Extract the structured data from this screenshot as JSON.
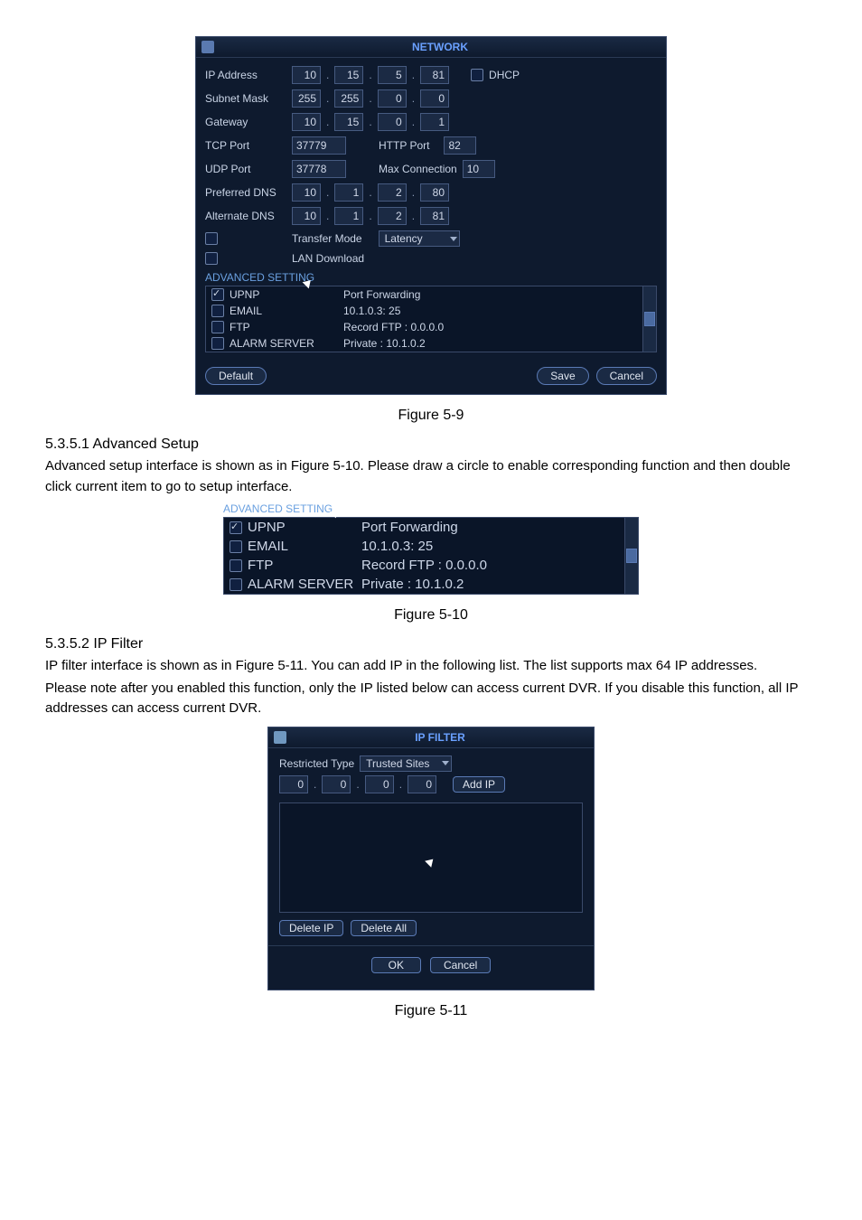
{
  "network": {
    "title_bar_icon_name": "computers-icon",
    "title": "NETWORK",
    "fields": {
      "ip_address_label": "IP Address",
      "ip_address": [
        "10",
        "15",
        "5",
        "81"
      ],
      "dhcp_label": "DHCP",
      "subnet_mask_label": "Subnet Mask",
      "subnet_mask": [
        "255",
        "255",
        "0",
        "0"
      ],
      "gateway_label": "Gateway",
      "gateway": [
        "10",
        "15",
        "0",
        "1"
      ],
      "tcp_port_label": "TCP Port",
      "tcp_port": "37779",
      "http_port_label": "HTTP Port",
      "http_port": "82",
      "udp_port_label": "UDP Port",
      "udp_port": "37778",
      "max_conn_label": "Max Connection",
      "max_conn": "10",
      "preferred_dns_label": "Preferred DNS",
      "preferred_dns": [
        "10",
        "1",
        "2",
        "80"
      ],
      "alternate_dns_label": "Alternate DNS",
      "alternate_dns": [
        "10",
        "1",
        "2",
        "81"
      ],
      "transfer_mode_label": "Transfer Mode",
      "transfer_mode_value": "Latency",
      "lan_download_label": "LAN Download",
      "advanced_setting_label": "ADVANCED SETTING",
      "adv": [
        {
          "name": "UPNP",
          "value": "Port Forwarding",
          "checked": true
        },
        {
          "name": "EMAIL",
          "value": "10.1.0.3: 25",
          "checked": false
        },
        {
          "name": "FTP",
          "value": "Record FTP : 0.0.0.0",
          "checked": false
        },
        {
          "name": "ALARM SERVER",
          "value": "Private : 10.1.0.2",
          "checked": false
        }
      ]
    },
    "buttons": {
      "default": "Default",
      "save": "Save",
      "cancel": "Cancel"
    }
  },
  "figures": {
    "fig59": "Figure 5-9",
    "fig510": "Figure 5-10",
    "fig511": "Figure 5-11"
  },
  "doc": {
    "h1": "5.3.5.1  Advanced Setup",
    "p1": "Advanced setup interface is shown as in Figure 5-10. Please draw a circle to enable corresponding function and then double click current item to go to setup interface.",
    "h2": "5.3.5.2  IP Filter",
    "p2a": "IP filter interface is shown as in Figure 5-11. You can add IP in the following list.  The list supports max 64 IP addresses.",
    "p2b": "Please note after you enabled this function, only the IP listed below can access current DVR. If you disable this function, all IP addresses can access current DVR."
  },
  "advsetting_small": {
    "title": "ADVANCED SETTING",
    "items": [
      {
        "name": "UPNP",
        "value": "Port Forwarding",
        "checked": true
      },
      {
        "name": "EMAIL",
        "value": "10.1.0.3: 25",
        "checked": false
      },
      {
        "name": "FTP",
        "value": "Record FTP : 0.0.0.0",
        "checked": false
      },
      {
        "name": "ALARM SERVER",
        "value": "Private : 10.1.0.2",
        "checked": false
      }
    ]
  },
  "ipfilter": {
    "title_icon_name": "filter-icon",
    "title": "IP FILTER",
    "restricted_type_label": "Restricted Type",
    "restricted_type_value": "Trusted Sites",
    "ip": [
      "0",
      "0",
      "0",
      "0"
    ],
    "add_ip": "Add IP",
    "delete_ip": "Delete IP",
    "delete_all": "Delete All",
    "ok": "OK",
    "cancel": "Cancel"
  }
}
